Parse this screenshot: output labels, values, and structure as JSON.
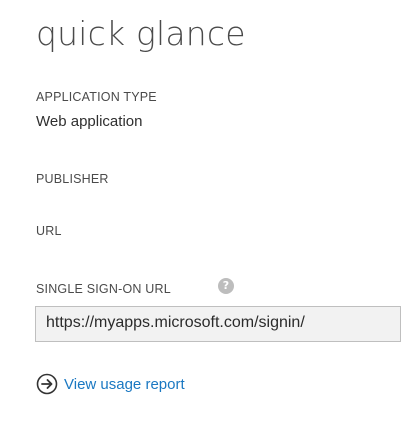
{
  "panel": {
    "title": "quick glance"
  },
  "fields": {
    "application_type": {
      "label": "APPLICATION TYPE",
      "value": "Web application"
    },
    "publisher": {
      "label": "PUBLISHER"
    },
    "url": {
      "label": "URL"
    },
    "single_sign_on_url": {
      "label": "SINGLE SIGN-ON URL",
      "help_icon": "question-circle-icon",
      "help_glyph": "?",
      "value": "https://myapps.microsoft.com/signin/"
    }
  },
  "actions": {
    "view_usage_report": {
      "label": "View usage report",
      "icon": "arrow-right-circle-icon"
    }
  },
  "colors": {
    "link": "#1a78c2",
    "text": "#333333",
    "field_background": "#f2f2f2",
    "field_border": "#bfbfbf",
    "help_icon": "#bdbdbd"
  }
}
